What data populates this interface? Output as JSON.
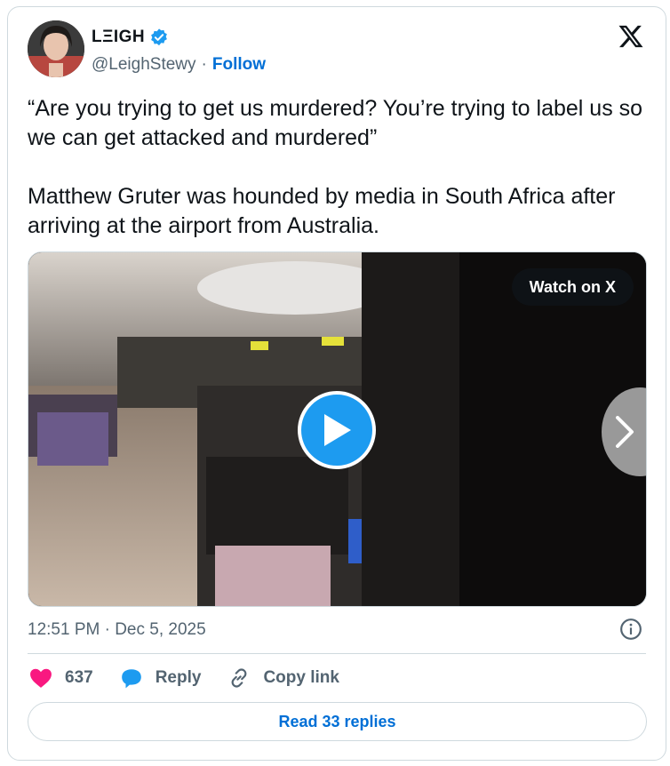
{
  "author": {
    "display_name": "LΞIGH",
    "handle": "@LeighStewy",
    "separator": "·",
    "follow_label": "Follow",
    "verified": true
  },
  "tweet": {
    "text": "“Are you trying to get us murdered? You’re trying to label us so we can get attacked and murdered”\n\nMatthew Gruter was hounded by media in South Africa after arriving at the airport from Australia.",
    "timestamp": "12:51 PM · Dec 5, 2025"
  },
  "media": {
    "watch_label": "Watch on X"
  },
  "actions": {
    "likes_count": "637",
    "reply_label": "Reply",
    "copy_link_label": "Copy link"
  },
  "read_replies_label": "Read 33 replies",
  "colors": {
    "accent": "#1d9bf0",
    "link": "#006fd6",
    "like": "#f91880",
    "muted": "#536471",
    "border": "#cfd9de"
  },
  "icons": [
    "verified-badge-icon",
    "x-logo-icon",
    "play-icon",
    "chevron-right-icon",
    "info-icon",
    "heart-icon",
    "reply-bubble-icon",
    "link-icon"
  ]
}
